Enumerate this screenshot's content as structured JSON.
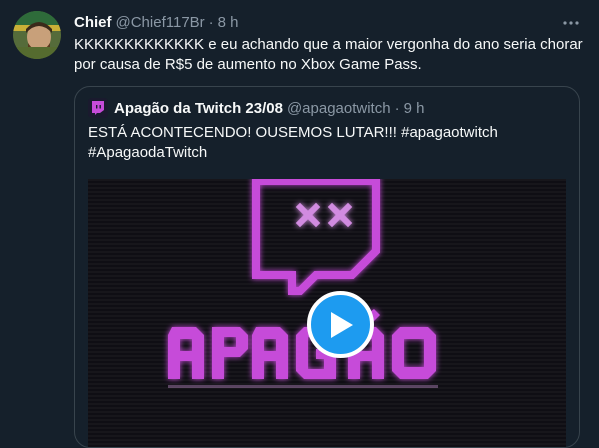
{
  "tweet": {
    "author_name": "Chief",
    "author_handle": "@Chief117Br",
    "separator": "·",
    "time": "8 h",
    "text": "KKKKKKKKKKKKK e eu achando que a maior vergonha do ano seria chorar por causa de R$5 de aumento no Xbox Game Pass."
  },
  "quoted": {
    "author_name": "Apagão da Twitch 23/08",
    "author_handle": "@apagaotwitch",
    "separator": "·",
    "time": "9 h",
    "text_line1": "ESTÁ ACONTECENDO! OUSEMOS LUTAR!!!  #apagaotwitch",
    "text_line2": "#ApagaodaTwitch",
    "media": {
      "type": "video",
      "overlay_text": "APAGÃO",
      "icon": "twitch-dead-face"
    }
  },
  "icons": {
    "more": "more-horizontal-icon",
    "play": "play-icon"
  },
  "colors": {
    "background": "#15202b",
    "text": "#f7f9f9",
    "secondary": "#8b98a5",
    "border": "#38444d",
    "accent": "#1d9bf0",
    "neon": "#c64cd9"
  }
}
